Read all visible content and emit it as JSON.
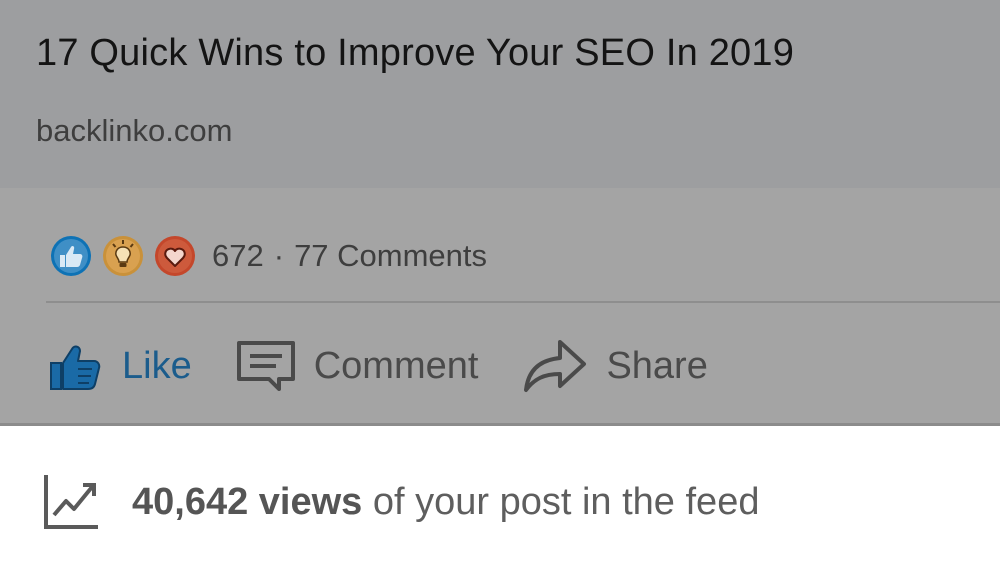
{
  "post": {
    "title": "17 Quick Wins to Improve Your SEO In 2019",
    "domain": "backlinko.com"
  },
  "social": {
    "reactions": [
      {
        "icon": "thumbs-up-icon",
        "color": "#0e72b5"
      },
      {
        "icon": "lightbulb-icon",
        "color": "#c9913a"
      },
      {
        "icon": "heart-icon",
        "color": "#c4472b"
      }
    ],
    "reaction_count": "672",
    "separator": "·",
    "comments_count": "77 Comments"
  },
  "actions": {
    "like_label": "Like",
    "comment_label": "Comment",
    "share_label": "Share"
  },
  "stats": {
    "views": "40,642 views",
    "suffix": " of your post in the feed"
  },
  "colors": {
    "like_blue": "#1b5c8c",
    "card_gray": "#9d9ea0",
    "social_gray": "#a4a4a4"
  }
}
